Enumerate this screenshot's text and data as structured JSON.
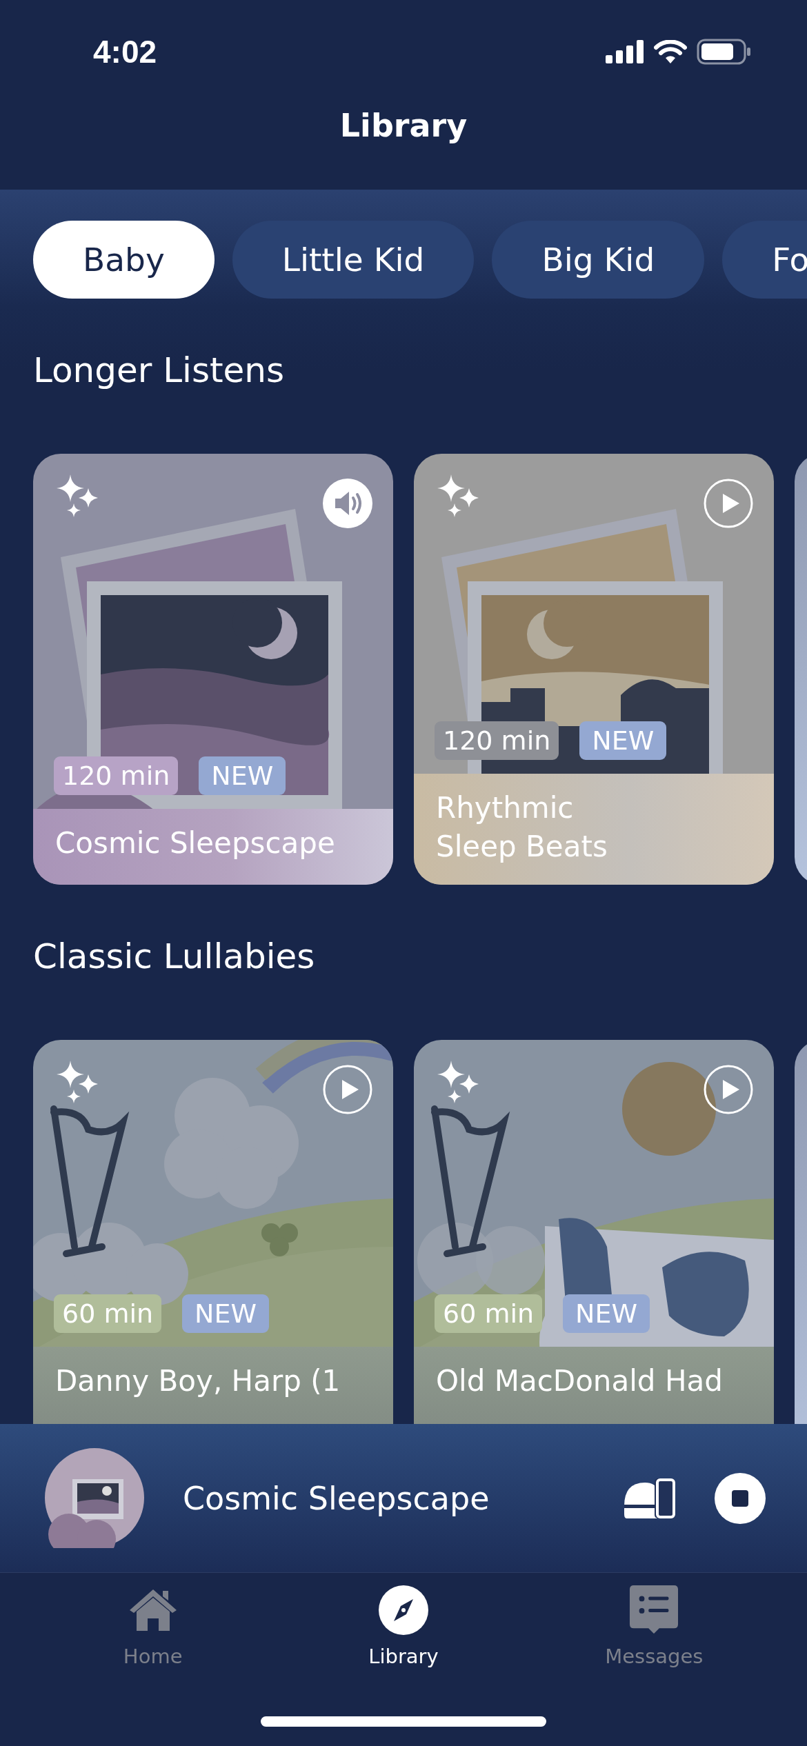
{
  "status_bar": {
    "time": "4:02"
  },
  "header": {
    "title": "Library"
  },
  "categories": [
    {
      "label": "Baby",
      "selected": true
    },
    {
      "label": "Little Kid",
      "selected": false
    },
    {
      "label": "Big Kid",
      "selected": false
    },
    {
      "label": "Fo",
      "selected": false
    }
  ],
  "sections": [
    {
      "title": "Longer Listens",
      "cards": [
        {
          "title": "Cosmic Sleepscape",
          "duration": "120 min",
          "badge": "NEW",
          "playing": true,
          "kind": "night-frame"
        },
        {
          "title": "Rhythmic\nSleep Beats",
          "duration": "120 min",
          "badge": "NEW",
          "playing": false,
          "kind": "dusk-frame"
        }
      ]
    },
    {
      "title": "Classic Lullabies",
      "cards": [
        {
          "title": "Danny Boy, Harp (1",
          "duration": "60 min",
          "badge": "NEW",
          "playing": false,
          "kind": "harp-rainbow"
        },
        {
          "title": "Old MacDonald Had",
          "duration": "60 min",
          "badge": "NEW",
          "playing": false,
          "kind": "harp-cow"
        }
      ]
    }
  ],
  "now_playing": {
    "title": "Cosmic Sleepscape"
  },
  "tabs": [
    {
      "label": "Home",
      "selected": false,
      "kind": "home"
    },
    {
      "label": "Library",
      "selected": true,
      "kind": "library"
    },
    {
      "label": "Messages",
      "selected": false,
      "kind": "messages"
    }
  ]
}
